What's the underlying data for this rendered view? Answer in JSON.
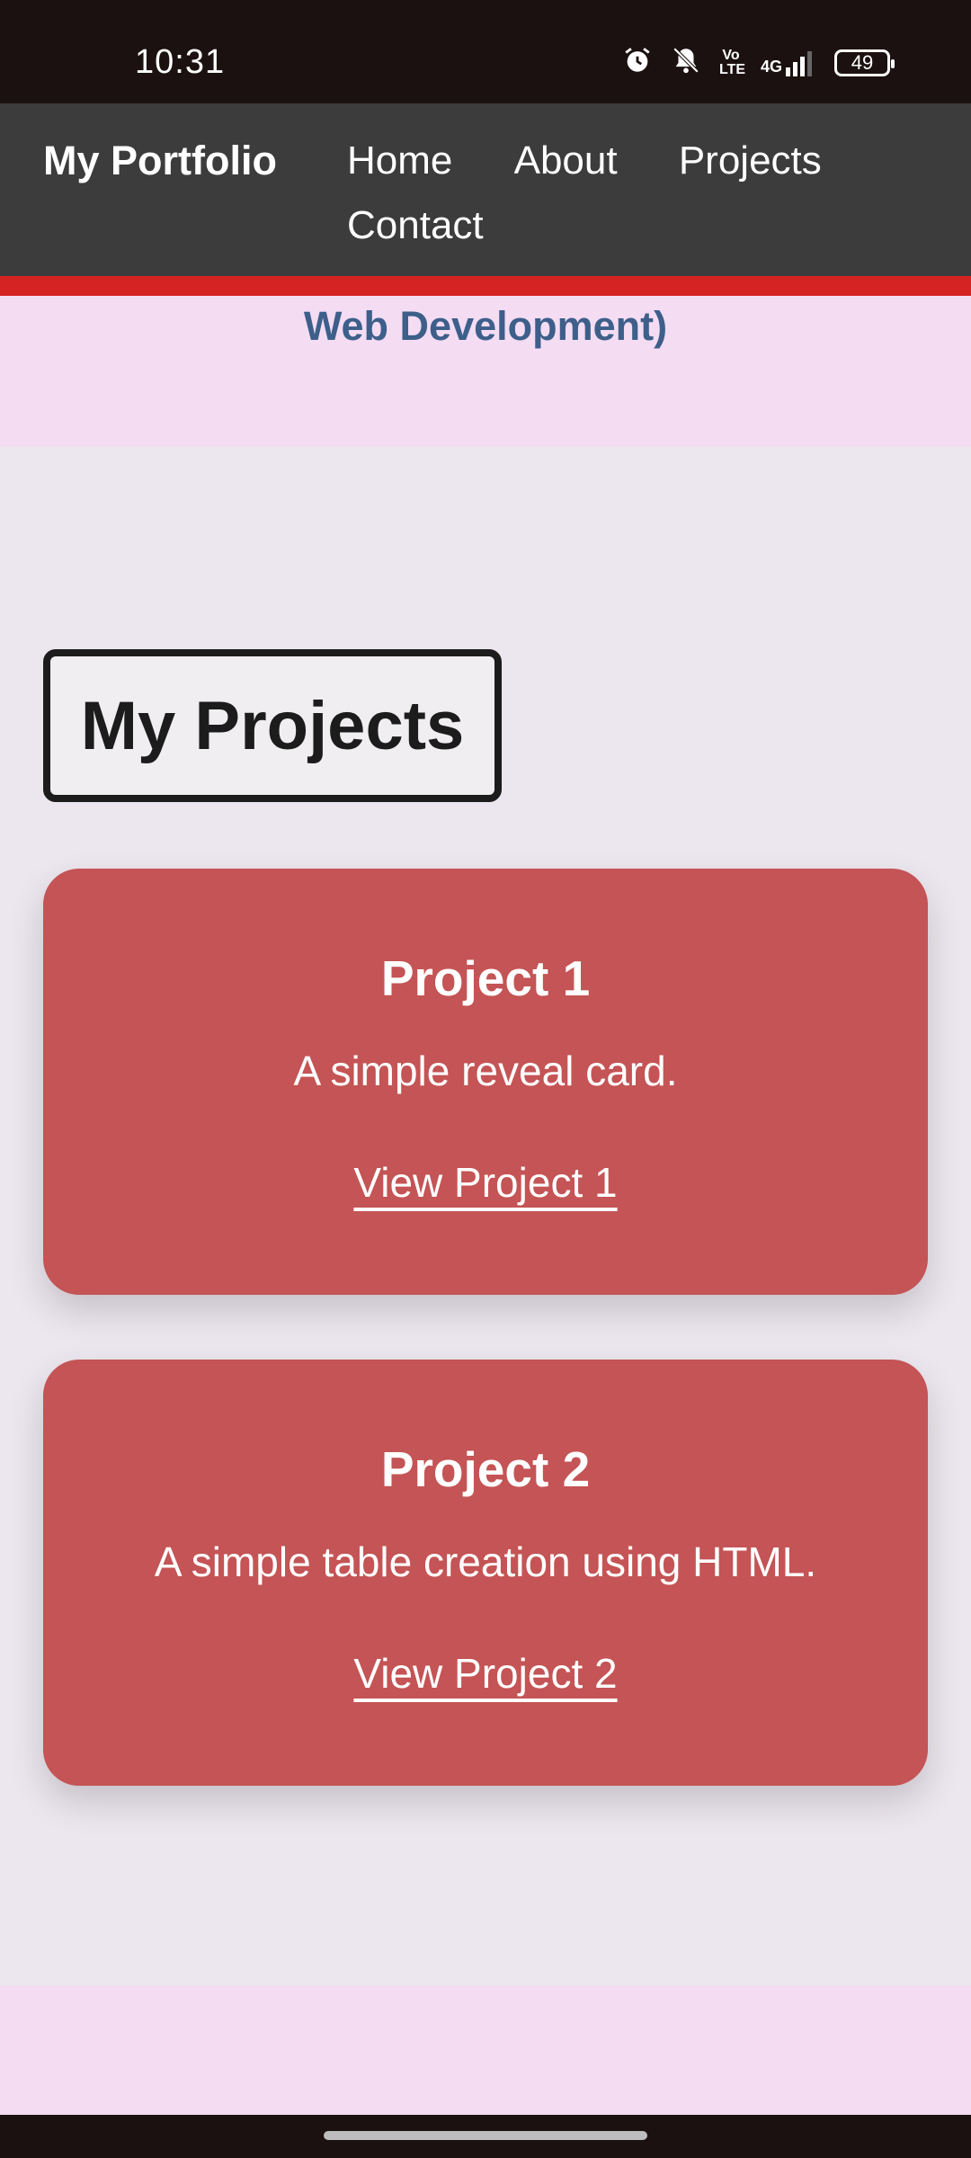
{
  "status_bar": {
    "time": "10:31",
    "volte": "Vo\nLTE",
    "network": "4G",
    "battery": "49",
    "icons": [
      "alarm-icon",
      "bell-off-icon",
      "volte-icon",
      "signal-icon",
      "battery-icon"
    ]
  },
  "nav": {
    "brand": "My Portfolio",
    "links": [
      "Home",
      "About",
      "Projects",
      "Contact"
    ]
  },
  "hero": {
    "text": "Web Development)"
  },
  "projects": {
    "title": "My Projects",
    "items": [
      {
        "title": "Project 1",
        "description": "A simple reveal card.",
        "link": "View Project 1"
      },
      {
        "title": "Project 2",
        "description": "A simple table creation using HTML.",
        "link": "View Project 2"
      }
    ]
  },
  "colors": {
    "nav_bg": "#3c3c3c",
    "accent_red": "#d52222",
    "card_bg": "#c45455",
    "hero_bg": "#f4dcf3",
    "hero_text": "#3d5f8a"
  }
}
